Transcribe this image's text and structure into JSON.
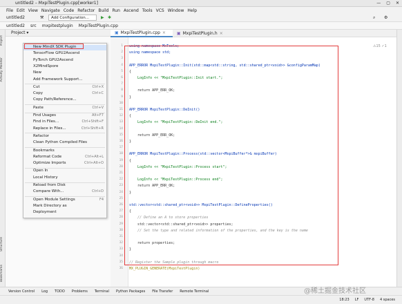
{
  "window": {
    "title": "untitled2 – MxpiTestPlugin.cpp[worker1]",
    "buttons": [
      "—",
      "▢",
      "✕"
    ]
  },
  "menu": [
    "File",
    "Edit",
    "View",
    "Navigate",
    "Code",
    "Refactor",
    "Build",
    "Run",
    "Ascend",
    "Tools",
    "VCS",
    "Window",
    "Help"
  ],
  "toolbar": {
    "project": "untitled2",
    "config": "Add Configuration..."
  },
  "navbar": {
    "crumbs": [
      "untitled2",
      "src",
      "mxpitestplugin",
      "MxpiTestPlugin.cpp"
    ]
  },
  "project_header": "Project ▾",
  "left_labels": {
    "project": "Project",
    "activity": "Activity Monitor",
    "structure": "Structure",
    "bookmarks": "Bookmarks"
  },
  "tabs": [
    {
      "label": "MxpiTestPlugin.cpp",
      "active": true
    },
    {
      "label": "MxpiTestPlugin.h",
      "active": false
    }
  ],
  "context_menu": {
    "items": [
      {
        "label": "New MindX SDK Plugin",
        "shortcut": "",
        "highlight": true
      },
      {
        "label": "TensorFlow GPU2Ascend",
        "shortcut": ""
      },
      {
        "label": "PyTorch GPU2Ascend",
        "shortcut": ""
      },
      {
        "label": "X2MindSpore",
        "shortcut": ""
      },
      {
        "label": "New",
        "shortcut": ""
      },
      {
        "label": "Add Framework Support...",
        "shortcut": ""
      },
      {
        "label": "Cut",
        "shortcut": "Ctrl+X"
      },
      {
        "label": "Copy",
        "shortcut": "Ctrl+C"
      },
      {
        "label": "Copy Path/Reference...",
        "shortcut": ""
      },
      {
        "label": "Paste",
        "shortcut": "Ctrl+V"
      },
      {
        "label": "Find Usages",
        "shortcut": "Alt+F7"
      },
      {
        "label": "Find in Files...",
        "shortcut": "Ctrl+Shift+F"
      },
      {
        "label": "Replace in Files...",
        "shortcut": "Ctrl+Shift+R"
      },
      {
        "label": "Refactor",
        "shortcut": ""
      },
      {
        "label": "Clean Python Compiled Files",
        "shortcut": ""
      },
      {
        "label": "Bookmarks",
        "shortcut": ""
      },
      {
        "label": "Reformat Code",
        "shortcut": "Ctrl+Alt+L"
      },
      {
        "label": "Optimize Imports",
        "shortcut": "Ctrl+Alt+O"
      },
      {
        "label": "Open In",
        "shortcut": ""
      },
      {
        "label": "Local History",
        "shortcut": ""
      },
      {
        "label": "Reload from Disk",
        "shortcut": ""
      },
      {
        "label": "Compare With...",
        "shortcut": "Ctrl+D"
      },
      {
        "label": "Open Module Settings",
        "shortcut": "F4"
      },
      {
        "label": "Mark Directory as",
        "shortcut": ""
      },
      {
        "label": "Deployment",
        "shortcut": ""
      }
    ]
  },
  "code": {
    "lines": [
      {
        "n": "1",
        "text": "using namespace MxTools;"
      },
      {
        "n": "2",
        "text": "using namespace std;"
      },
      {
        "n": "3",
        "text": ""
      },
      {
        "n": "4",
        "text": "APP_ERROR MxpiTestPlugin::Init(std::map<std::string, std::shared_ptr<void>> &configParamMap)"
      },
      {
        "n": "5",
        "text": "{"
      },
      {
        "n": "6",
        "text": "    LogInfo << \"MxpiTestPlugin::Init start.\";"
      },
      {
        "n": "7",
        "text": ""
      },
      {
        "n": "8",
        "text": "    return APP_ERR_OK;"
      },
      {
        "n": "9",
        "text": "}"
      },
      {
        "n": "10",
        "text": ""
      },
      {
        "n": "11",
        "text": "APP_ERROR MxpiTestPlugin::DeInit()"
      },
      {
        "n": "12",
        "text": "{"
      },
      {
        "n": "13",
        "text": "    LogInfo << \"MxpiTestPlugin::DeInit end.\";"
      },
      {
        "n": "14",
        "text": ""
      },
      {
        "n": "15",
        "text": "    return APP_ERR_OK;"
      },
      {
        "n": "16",
        "text": "}"
      },
      {
        "n": "17",
        "text": ""
      },
      {
        "n": "18",
        "text": "APP_ERROR MxpiTestPlugin::Process(std::vector<MxpiBuffer*>& mxpiBuffer)"
      },
      {
        "n": "19",
        "text": "{"
      },
      {
        "n": "20",
        "text": "    LogInfo << \"MxpiTestPlugin::Process start\";"
      },
      {
        "n": "21",
        "text": ""
      },
      {
        "n": "22",
        "text": "    LogInfo << \"MxpiTestPlugin::Process end\";"
      },
      {
        "n": "23",
        "text": "    return APP_ERR_OK;"
      },
      {
        "n": "24",
        "text": "}"
      },
      {
        "n": "25",
        "text": ""
      },
      {
        "n": "26",
        "text": "std::vector<std::shared_ptr<void>> MxpiTestPlugin::DefineProperties()"
      },
      {
        "n": "27",
        "text": "{"
      },
      {
        "n": "28",
        "text": "    // Define an A to store properties"
      },
      {
        "n": "29",
        "text": "    std::vector<std::shared_ptr<void>> properties;"
      },
      {
        "n": "30",
        "text": "    // Set the type and related information of the properties, and the key is the name"
      },
      {
        "n": "31",
        "text": ""
      },
      {
        "n": "32",
        "text": "    return properties;"
      },
      {
        "n": "33",
        "text": "}"
      },
      {
        "n": "34",
        "text": ""
      },
      {
        "n": "35",
        "text": "// Register the Sample plugin through macro"
      },
      {
        "n": "36",
        "text": "MX_PLUGIN_GENERATE(MxpiTestPlugin)"
      }
    ]
  },
  "bottom_tools": [
    "Version Control",
    "Log",
    "TODO",
    "Problems",
    "Terminal",
    "Python Packages",
    "File Transfer",
    "Remote Terminal"
  ],
  "status": {
    "left": "",
    "position": "18:23",
    "lf": "LF",
    "encoding": "UTF-8",
    "indent": "4 spaces"
  },
  "editor_badge": "⚠15  ✓1",
  "watermark": "@稀土掘金技术社区"
}
